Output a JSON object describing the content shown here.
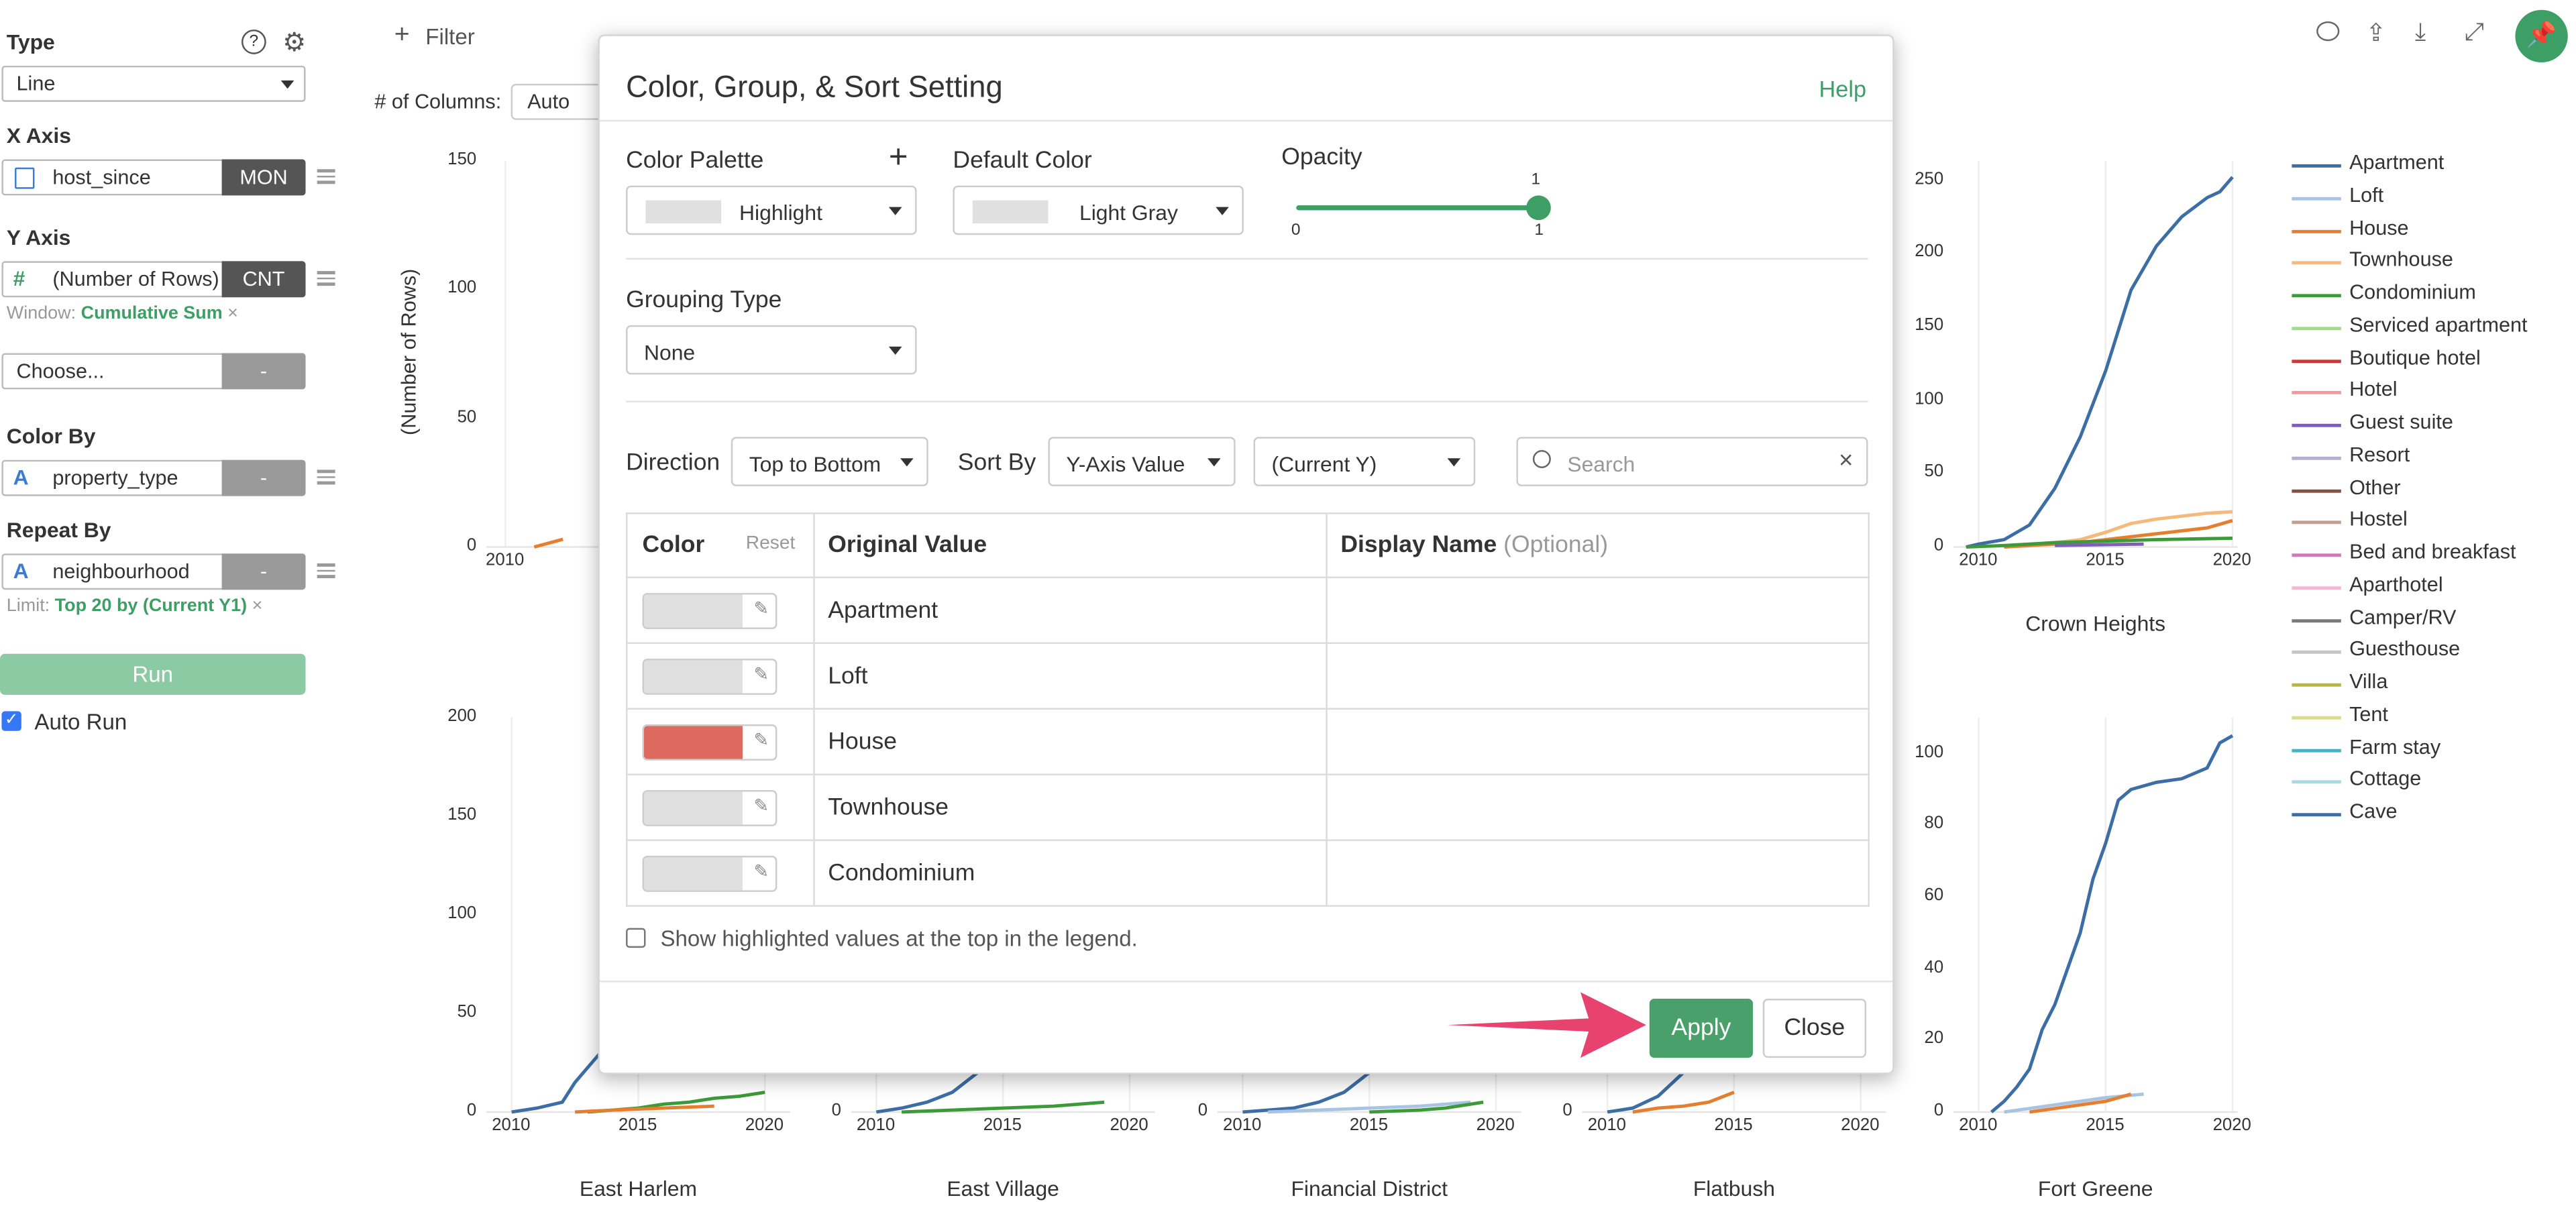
{
  "left_panel": {
    "type": {
      "title": "Type",
      "value": "Line"
    },
    "x_axis": {
      "title": "X Axis",
      "field": "host_since",
      "agg": "MON"
    },
    "y_axis": {
      "title": "Y Axis",
      "field": "(Number of Rows)",
      "agg": "CNT",
      "window_label": "Window:",
      "window_value": "Cumulative Sum"
    },
    "extra": {
      "placeholder": "Choose...",
      "agg": "-"
    },
    "color_by": {
      "title": "Color By",
      "field": "property_type",
      "agg": "-"
    },
    "repeat_by": {
      "title": "Repeat By",
      "field": "neighbourhood",
      "agg": "-",
      "limit_label": "Limit:",
      "limit_value": "Top 20 by (Current Y1)"
    },
    "run_label": "Run",
    "auto_run_label": "Auto Run"
  },
  "toolbar": {
    "filter_label": "Filter",
    "columns_label": "# of Columns:",
    "columns_value": "Auto"
  },
  "chart_data": [
    {
      "type": "line",
      "title": "",
      "ylabel": "(Number of Rows)",
      "ylim": [
        0,
        150
      ],
      "yticks": [
        "150",
        "100",
        "50",
        "0"
      ],
      "xticks": [
        "2010"
      ],
      "series": [
        {
          "name": "House",
          "x": [
            2011.5,
            2012,
            2012.5,
            2013
          ],
          "y": [
            0,
            1,
            2,
            3
          ]
        }
      ]
    },
    {
      "type": "line",
      "title": "Crown Heights",
      "ylim": [
        0,
        250
      ],
      "yticks": [
        "250",
        "200",
        "150",
        "100",
        "50",
        "0"
      ],
      "xticks": [
        "2010",
        "2015",
        "2020"
      ],
      "series": [
        {
          "name": "Apartment",
          "x": [
            2009.5,
            2010,
            2011,
            2012,
            2013,
            2014,
            2015,
            2016,
            2017,
            2018,
            2019,
            2019.5,
            2020
          ],
          "y": [
            0,
            2,
            5,
            15,
            40,
            75,
            120,
            175,
            205,
            225,
            238,
            242,
            252
          ]
        },
        {
          "name": "Townhouse",
          "x": [
            2011,
            2012,
            2013,
            2014,
            2015,
            2016,
            2017,
            2018,
            2019,
            2020
          ],
          "y": [
            0,
            1,
            3,
            5,
            10,
            16,
            19,
            21,
            23,
            24
          ]
        },
        {
          "name": "House",
          "x": [
            2011,
            2012,
            2013,
            2014,
            2015,
            2016,
            2017,
            2018,
            2019,
            2020
          ],
          "y": [
            0,
            1,
            2,
            3,
            5,
            7,
            9,
            11,
            13,
            18
          ]
        },
        {
          "name": "Condominium",
          "x": [
            2009.5,
            2011,
            2013,
            2015,
            2017,
            2020
          ],
          "y": [
            0,
            1,
            3,
            4,
            5,
            6
          ]
        },
        {
          "name": "Guest suite",
          "x": [
            2013,
            2016.5
          ],
          "y": [
            1,
            2
          ]
        }
      ]
    },
    {
      "type": "line",
      "title": "East Harlem",
      "ylim": [
        0,
        200
      ],
      "yticks": [
        "200",
        "150",
        "100",
        "50",
        "0"
      ],
      "xticks": [
        "2010",
        "2015",
        "2020"
      ],
      "series": [
        {
          "name": "Apartment",
          "x": [
            2010,
            2011,
            2012,
            2012.5,
            2013.5
          ],
          "y": [
            0,
            2,
            5,
            15,
            30
          ]
        },
        {
          "name": "Condominium",
          "x": [
            2013,
            2015,
            2016,
            2017,
            2018,
            2019,
            2020
          ],
          "y": [
            0,
            2,
            4,
            5,
            7,
            8,
            10
          ]
        },
        {
          "name": "House",
          "x": [
            2012.5,
            2014,
            2016,
            2018
          ],
          "y": [
            0,
            1,
            2,
            3
          ]
        }
      ]
    },
    {
      "type": "line",
      "title": "East Village",
      "xticks": [
        "2010",
        "2015",
        "2020"
      ],
      "series": [
        {
          "name": "Apartment",
          "x": [
            2010,
            2011,
            2012,
            2013,
            2014
          ],
          "y": [
            0,
            2,
            5,
            10,
            20
          ]
        },
        {
          "name": "Condominium",
          "x": [
            2011,
            2013,
            2015,
            2017,
            2019
          ],
          "y": [
            0,
            1,
            2,
            3,
            5
          ]
        }
      ]
    },
    {
      "type": "line",
      "title": "Financial District",
      "xticks": [
        "2010",
        "2015",
        "2020"
      ],
      "series": [
        {
          "name": "Apartment",
          "x": [
            2010,
            2012,
            2013,
            2014,
            2015
          ],
          "y": [
            0,
            2,
            5,
            10,
            20
          ]
        },
        {
          "name": "Loft",
          "x": [
            2011,
            2013,
            2015,
            2017,
            2019
          ],
          "y": [
            0,
            1,
            2,
            3,
            5
          ]
        },
        {
          "name": "Condominium",
          "x": [
            2015,
            2017,
            2018,
            2019.5
          ],
          "y": [
            0,
            1,
            2,
            5
          ]
        }
      ]
    },
    {
      "type": "line",
      "title": "Flatbush",
      "xticks": [
        "2010",
        "2015",
        "2020"
      ],
      "series": [
        {
          "name": "Apartment",
          "x": [
            2010,
            2011,
            2012,
            2013
          ],
          "y": [
            0,
            2,
            8,
            20
          ]
        },
        {
          "name": "House",
          "x": [
            2011,
            2012,
            2013,
            2014,
            2015
          ],
          "y": [
            0,
            2,
            3,
            5,
            10
          ]
        }
      ]
    },
    {
      "type": "line",
      "title": "Fort Greene",
      "ylim": [
        0,
        100
      ],
      "yticks": [
        "100",
        "80",
        "60",
        "40",
        "20",
        "0"
      ],
      "xticks": [
        "2010",
        "2015",
        "2020"
      ],
      "series": [
        {
          "name": "Apartment",
          "x": [
            2010.5,
            2011,
            2011.5,
            2012,
            2012.5,
            2013,
            2013.5,
            2014,
            2014.5,
            2015,
            2015.5,
            2016,
            2017,
            2018,
            2019,
            2019.5,
            2020
          ],
          "y": [
            0,
            3,
            7,
            12,
            23,
            30,
            40,
            50,
            65,
            75,
            87,
            90,
            92,
            93,
            96,
            103,
            105
          ]
        },
        {
          "name": "Loft",
          "x": [
            2011,
            2012,
            2013,
            2014,
            2015,
            2016.5
          ],
          "y": [
            0,
            1,
            2,
            3,
            4,
            5
          ]
        },
        {
          "name": "House",
          "x": [
            2012,
            2013,
            2014,
            2015,
            2016
          ],
          "y": [
            0,
            1,
            2,
            3,
            5
          ]
        }
      ]
    }
  ],
  "legend": {
    "items": [
      {
        "label": "Apartment",
        "color": "#3c6ea5"
      },
      {
        "label": "Loft",
        "color": "#a9c4e2"
      },
      {
        "label": "House",
        "color": "#e67e2f"
      },
      {
        "label": "Townhouse",
        "color": "#f4b97b"
      },
      {
        "label": "Condominium",
        "color": "#3d9a38"
      },
      {
        "label": "Serviced apartment",
        "color": "#9fdc8a"
      },
      {
        "label": "Boutique hotel",
        "color": "#c93a37"
      },
      {
        "label": "Hotel",
        "color": "#f2999a"
      },
      {
        "label": "Guest suite",
        "color": "#7f5eb6"
      },
      {
        "label": "Resort",
        "color": "#b8a9d6"
      },
      {
        "label": "Other",
        "color": "#805246"
      },
      {
        "label": "Hostel",
        "color": "#c39d92"
      },
      {
        "label": "Bed and breakfast",
        "color": "#d774c0"
      },
      {
        "label": "Aparthotel",
        "color": "#f3b8d3"
      },
      {
        "label": "Camper/RV",
        "color": "#7a7a7a"
      },
      {
        "label": "Guesthouse",
        "color": "#c6c6c6"
      },
      {
        "label": "Villa",
        "color": "#b5b83a"
      },
      {
        "label": "Tent",
        "color": "#dbdb8f"
      },
      {
        "label": "Farm stay",
        "color": "#3bb6cc"
      },
      {
        "label": "Cottage",
        "color": "#a6dbe6"
      },
      {
        "label": "Cave",
        "color": "#3c6ea5"
      }
    ]
  },
  "modal": {
    "title": "Color, Group, & Sort Setting",
    "help": "Help",
    "palette_label": "Color Palette",
    "palette_value": "Highlight",
    "default_color_label": "Default Color",
    "default_color_value": "Light Gray",
    "opacity_label": "Opacity",
    "opacity_value": "1",
    "opacity_min": "0",
    "opacity_max": "1",
    "opacity_level": 1.0,
    "grouping_label": "Grouping Type",
    "grouping_value": "None",
    "direction_label": "Direction",
    "direction_value": "Top to Bottom",
    "sortby_label": "Sort By",
    "sortby_value": "Y-Axis Value",
    "sortby_target": "(Current Y)",
    "search_placeholder": "Search",
    "table": {
      "col_color": "Color",
      "col_reset": "Reset",
      "col_original": "Original Value",
      "col_display": "Display Name",
      "col_display_hint": "(Optional)",
      "rows": [
        {
          "value": "Apartment",
          "color": "#e0e0e0"
        },
        {
          "value": "Loft",
          "color": "#e0e0e0"
        },
        {
          "value": "House",
          "color": "#dc6a5e"
        },
        {
          "value": "Townhouse",
          "color": "#e0e0e0"
        },
        {
          "value": "Condominium",
          "color": "#e0e0e0"
        }
      ]
    },
    "highlight_checkbox": "Show highlighted values at the top in the legend.",
    "apply": "Apply",
    "close": "Close"
  }
}
